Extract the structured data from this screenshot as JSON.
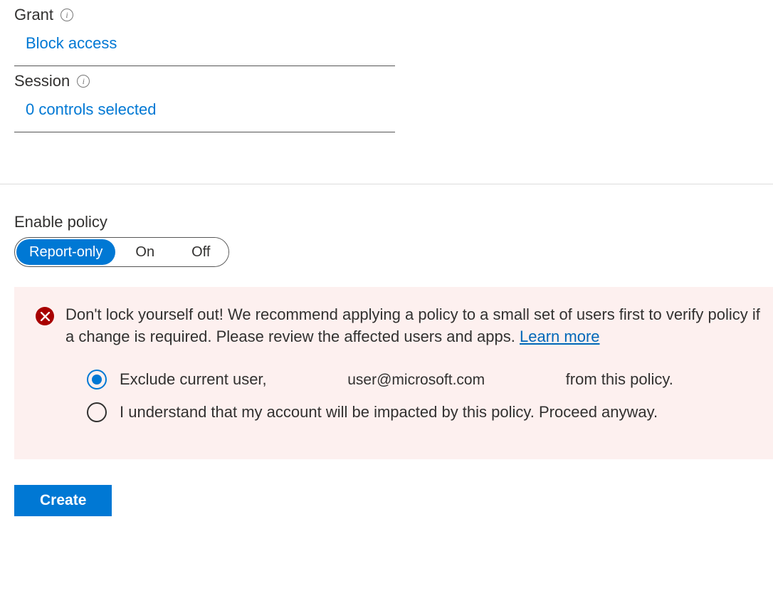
{
  "grant": {
    "label": "Grant",
    "value": "Block access"
  },
  "session": {
    "label": "Session",
    "value": "0 controls selected"
  },
  "enable_policy": {
    "label": "Enable policy",
    "options": {
      "report_only": "Report-only",
      "on": "On",
      "off": "Off"
    }
  },
  "warning": {
    "message": "Don't lock yourself out! We recommend applying a policy to a small set of users first to verify policy if a change is required. Please review the affected users and apps. ",
    "learn_more": "Learn more",
    "options": {
      "exclude_prefix": "Exclude current user,",
      "exclude_email": "user@microsoft.com",
      "exclude_suffix": "from this policy.",
      "understand": "I understand that my account will be impacted by this policy. Proceed anyway."
    }
  },
  "buttons": {
    "create": "Create"
  }
}
